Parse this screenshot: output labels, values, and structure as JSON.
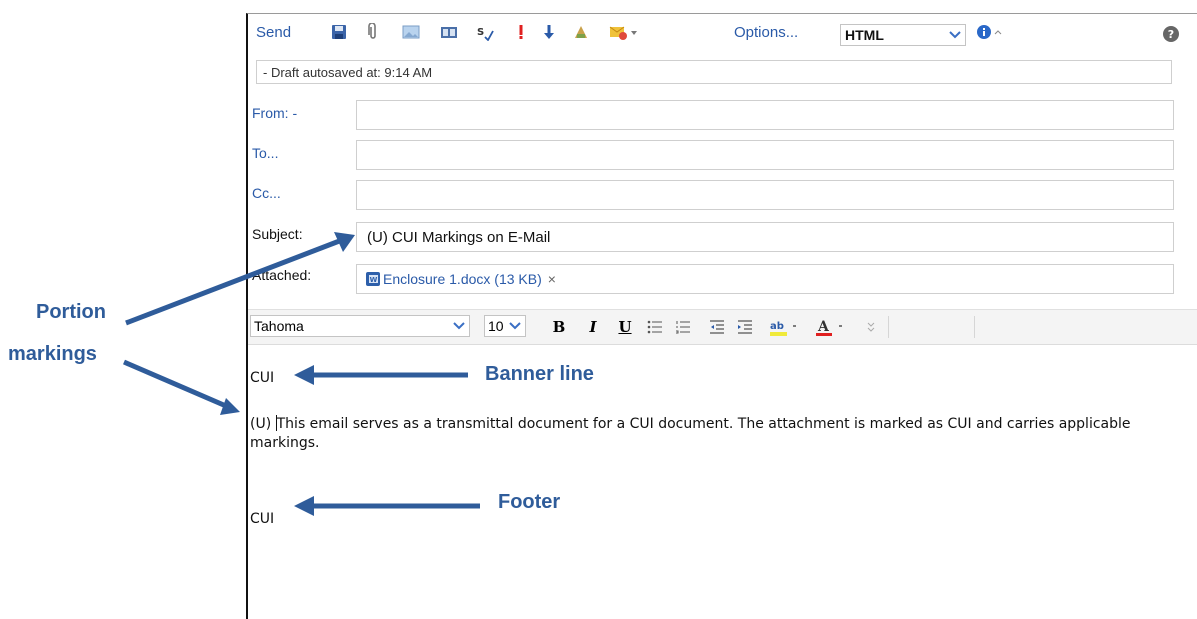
{
  "toolbar": {
    "send_label": "Send",
    "options_label": "Options...",
    "format_value": "HTML",
    "icons": [
      "save-icon",
      "paperclip-icon",
      "insert-image-icon",
      "address-book-icon",
      "spell-check-icon",
      "high-importance-icon",
      "low-importance-icon",
      "stationery-icon",
      "flag-icon",
      "info-icon",
      "help-icon"
    ]
  },
  "status": {
    "text": "- Draft autosaved at: 9:14 AM"
  },
  "fields": {
    "from_label": "From: -",
    "to_label": "To...",
    "cc_label": "Cc...",
    "subject_label": "Subject:",
    "subject_value": "(U) CUI Markings on E-Mail",
    "attached_label": "Attached:",
    "attachment_name": "Enclosure 1.docx (13 KB)",
    "remove_symbol": "×"
  },
  "format_bar": {
    "font": "Tahoma",
    "size": "10",
    "bold": "B",
    "italic": "I",
    "underline": "U",
    "font_color_letter": "A",
    "highlight_letter": "ab"
  },
  "body": {
    "banner": "CUI",
    "paragraph_marker": "(U) ",
    "paragraph_text": "This email serves as a transmittal document for a CUI document.  The attachment is marked as CUI and carries applicable markings.",
    "footer": "CUI"
  },
  "annotations": {
    "portion_line1": "Portion",
    "portion_line2": "markings",
    "banner": "Banner line",
    "footer": "Footer",
    "color": "#2f5c9a"
  }
}
